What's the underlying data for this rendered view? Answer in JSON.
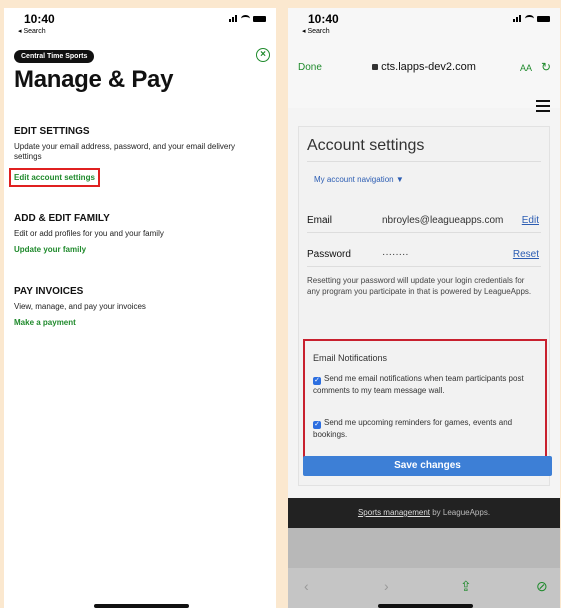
{
  "status": {
    "time": "10:40",
    "back": "◂ Search"
  },
  "left": {
    "brand": "Central Time Sports",
    "title": "Manage & Pay",
    "sections": [
      {
        "heading": "EDIT SETTINGS",
        "desc": "Update your email address, password, and your email delivery settings",
        "link": "Edit account settings"
      },
      {
        "heading": "ADD & EDIT FAMILY",
        "desc": "Edit or add profiles for you and your family",
        "link": "Update your family"
      },
      {
        "heading": "PAY INVOICES",
        "desc": "View, manage, and pay your invoices",
        "link": "Make a payment"
      }
    ]
  },
  "right": {
    "done": "Done",
    "url": "cts.lapps-dev2.com",
    "aa": "AA",
    "card_title": "Account settings",
    "account_nav": "My account navigation ▼",
    "email_label": "Email",
    "email_value": "nbroyles@leagueapps.com",
    "email_action": "Edit",
    "password_label": "Password",
    "password_value": "········",
    "password_action": "Reset",
    "reset_text": "Resetting your password will update your login credentials for any program you participate in that is powered by LeagueApps.",
    "notif_title": "Email Notifications",
    "notif_option_1": "Send me email notifications when team participants post comments to my team message wall.",
    "notif_option_2": "Send me upcoming reminders for games, events and bookings.",
    "save_label": "Save changes",
    "footer_link": "Sports management",
    "footer_suffix": " by LeagueApps."
  },
  "colors": {
    "accent_green": "#1f8a2c",
    "highlight_red": "#e02020",
    "link_blue": "#2c5db3",
    "button_blue": "#3d7fd6"
  }
}
